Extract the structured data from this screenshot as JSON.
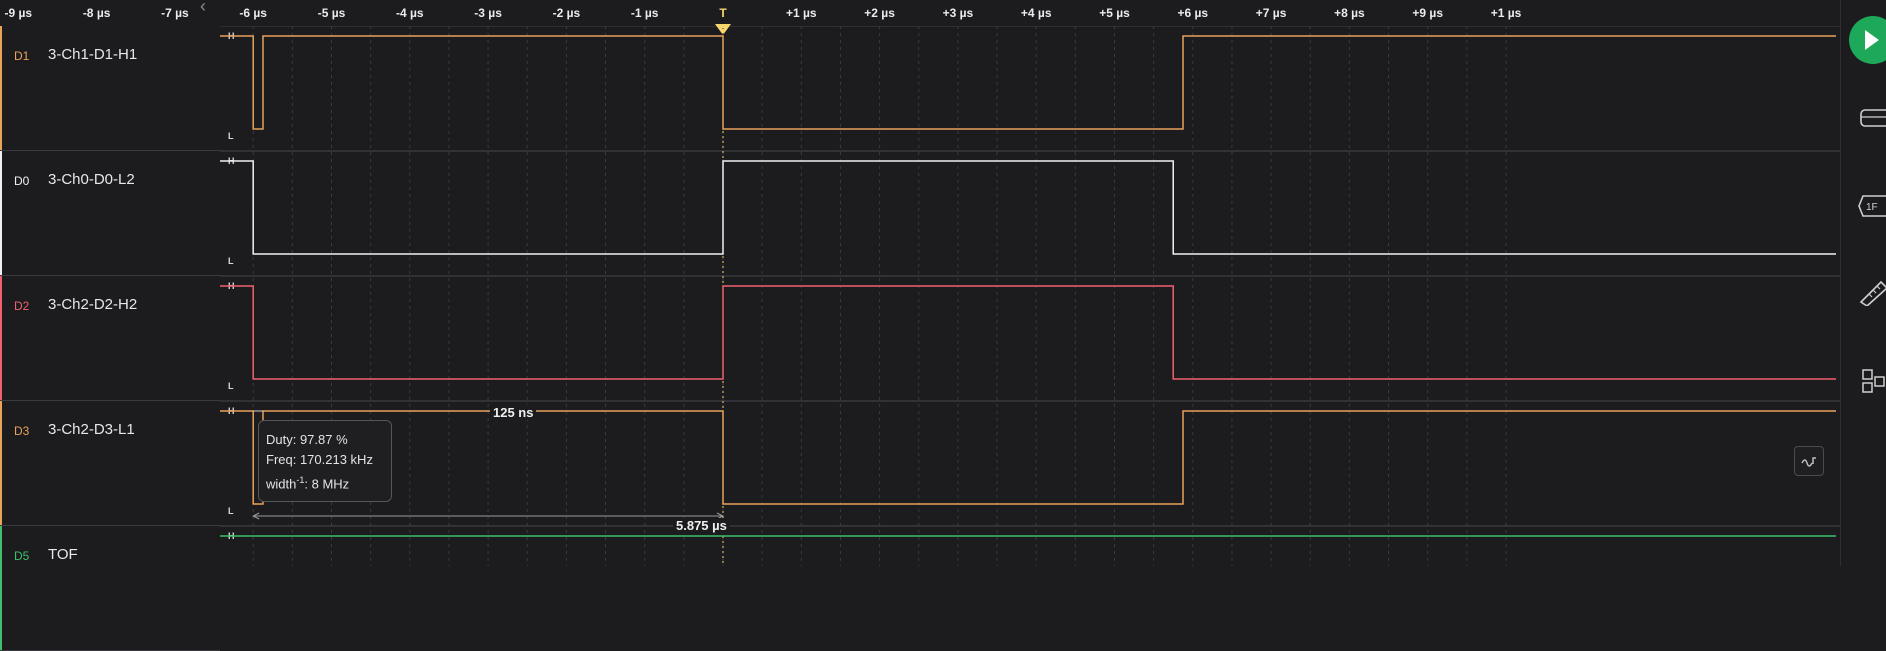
{
  "ruler": {
    "ticks": [
      {
        "label": "-9 µs",
        "t": -9
      },
      {
        "label": "-8 µs",
        "t": -8
      },
      {
        "label": "-7 µs",
        "t": -7
      },
      {
        "label": "-6 µs",
        "t": -6
      },
      {
        "label": "-5 µs",
        "t": -5
      },
      {
        "label": "-4 µs",
        "t": -4
      },
      {
        "label": "-3 µs",
        "t": -3
      },
      {
        "label": "-2 µs",
        "t": -2
      },
      {
        "label": "-1 µs",
        "t": -1
      },
      {
        "label": "+1 µs",
        "t": 1
      },
      {
        "label": "+2 µs",
        "t": 2
      },
      {
        "label": "+3 µs",
        "t": 3
      },
      {
        "label": "+4 µs",
        "t": 4
      },
      {
        "label": "+5 µs",
        "t": 5
      },
      {
        "label": "+6 µs",
        "t": 6
      },
      {
        "label": "+7 µs",
        "t": 7
      },
      {
        "label": "+8 µs",
        "t": 8
      },
      {
        "label": "+9 µs",
        "t": 9
      },
      {
        "label": "+1 µs",
        "t": 10
      }
    ],
    "trigger_label": "T",
    "trigger_t": 0,
    "back_icon": "chevron-left-icon"
  },
  "channels": [
    {
      "tag": "D1",
      "name": "3-Ch1-D1-H1",
      "color": "#e8a25a",
      "high_label": "H",
      "low_label": "L",
      "edges": [
        {
          "t": -6.0,
          "level": 0
        },
        {
          "t": -5.875,
          "level": 1
        },
        {
          "t": 0,
          "level": 0
        },
        {
          "t": 5.875,
          "level": 1
        }
      ],
      "start_level": 1
    },
    {
      "tag": "D0",
      "name": "3-Ch0-D0-L2",
      "color": "#f2f2f2",
      "high_label": "H",
      "low_label": "L",
      "edges": [
        {
          "t": -6.0,
          "level": 0
        },
        {
          "t": 0,
          "level": 1
        },
        {
          "t": 5.75,
          "level": 0
        }
      ],
      "start_level": 1
    },
    {
      "tag": "D2",
      "name": "3-Ch2-D2-H2",
      "color": "#f06070",
      "high_label": "H",
      "low_label": "L",
      "edges": [
        {
          "t": -6.0,
          "level": 0
        },
        {
          "t": 0,
          "level": 1
        },
        {
          "t": 5.75,
          "level": 0
        }
      ],
      "start_level": 1
    },
    {
      "tag": "D3",
      "name": "3-Ch2-D3-L1",
      "color": "#e8a25a",
      "high_label": "H",
      "low_label": "L",
      "edges": [
        {
          "t": -6.0,
          "level": 0
        },
        {
          "t": -5.875,
          "level": 1
        },
        {
          "t": 0,
          "level": 0
        },
        {
          "t": 5.875,
          "level": 1
        }
      ],
      "start_level": 1
    },
    {
      "tag": "D5",
      "name": "TOF",
      "color": "#3fbf6a",
      "high_label": "H",
      "low_label": "L",
      "edges": [],
      "start_level": 1
    }
  ],
  "measurement": {
    "duty": "Duty: 97.87 %",
    "freq": "Freq: 170.213 kHz",
    "width_prefix": "width",
    "width_sup": "-1",
    "width_value": ": 8 MHz",
    "pulse_label": "125 ns",
    "period_label": "5.875 µs"
  },
  "sidebar": {
    "icons": [
      "play-icon",
      "device-icon",
      "protocol-icon",
      "ruler-icon",
      "layout-icon"
    ],
    "accent": "#1ea85a"
  },
  "controls": {
    "waveform_button_icon": "waveform-toggle-icon"
  }
}
